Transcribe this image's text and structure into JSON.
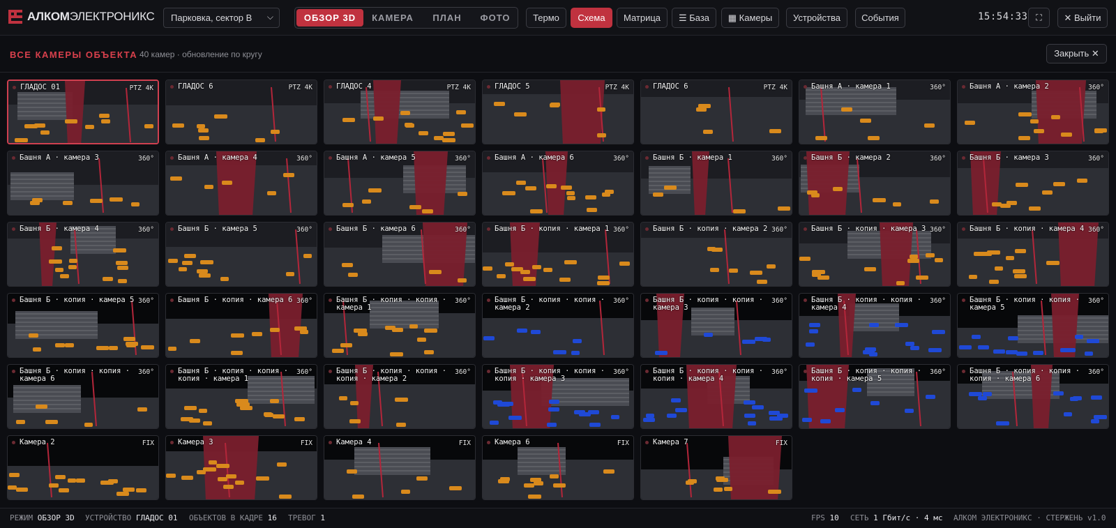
{
  "app": {
    "brand_bold": "АЛКОМ",
    "brand_rest": "ЭЛЕКТРОНИКС",
    "site_select": "Парковка, сектор В",
    "view_tabs": [
      "ОБЗОР 3D",
      "КАМЕРА",
      "ПЛАН",
      "ФОТО"
    ],
    "active_view": "ОБЗОР 3D",
    "toolbar": [
      "Термо",
      "Схема",
      "Матрица",
      "☰ База",
      "▦ Камеры",
      "Устройства",
      "События"
    ],
    "active_tool": "Схема",
    "clock": "15:54:33",
    "fullscreen_icon": "⛶",
    "exit_label": "✕ Выйти"
  },
  "panel": {
    "title": "ВСЕ КАМЕРЫ ОБЪЕКТА",
    "meta": "40 камер · обновление по кругу",
    "close_label": "Закрыть ✕"
  },
  "cameras": [
    {
      "name": "ГЛАДОС 01",
      "badge": "PTZ 4K"
    },
    {
      "name": "ГЛАДОС 6",
      "badge": "PTZ 4K"
    },
    {
      "name": "ГЛАДОС 4",
      "badge": "PTZ 4K"
    },
    {
      "name": "ГЛАДОС 5",
      "badge": "PTZ 4K"
    },
    {
      "name": "ГЛАДОС 6",
      "badge": "PTZ 4K"
    },
    {
      "name": "Башня А · камера 1",
      "badge": "360°"
    },
    {
      "name": "Башня А · камера 2",
      "badge": "360°"
    },
    {
      "name": "Башня А · камера 3",
      "badge": "360°"
    },
    {
      "name": "Башня А · камера 4",
      "badge": "360°"
    },
    {
      "name": "Башня А · камера 5",
      "badge": "360°"
    },
    {
      "name": "Башня А · камера 6",
      "badge": "360°"
    },
    {
      "name": "Башня Б · камера 1",
      "badge": "360°"
    },
    {
      "name": "Башня Б · камера 2",
      "badge": "360°"
    },
    {
      "name": "Башня Б · камера 3",
      "badge": "360°"
    },
    {
      "name": "Башня Б · камера 4",
      "badge": "360°"
    },
    {
      "name": "Башня Б · камера 5",
      "badge": "360°"
    },
    {
      "name": "Башня Б · камера 6",
      "badge": "360°"
    },
    {
      "name": "Башня Б · копия · камера 1",
      "badge": "360°"
    },
    {
      "name": "Башня Б · копия · камера 2",
      "badge": "360°"
    },
    {
      "name": "Башня Б · копия · камера 3",
      "badge": "360°"
    },
    {
      "name": "Башня Б · копия · камера 4",
      "badge": "360°"
    },
    {
      "name": "Башня Б · копия · камера 5",
      "badge": "360°"
    },
    {
      "name": "Башня Б · копия · камера 6",
      "badge": "360°"
    },
    {
      "name": "Башня Б · копия · копия · камера 1",
      "badge": "360°"
    },
    {
      "name": "Башня Б · копия · копия · камера 2",
      "badge": "360°"
    },
    {
      "name": "Башня Б · копия · копия · камера 3",
      "badge": "360°"
    },
    {
      "name": "Башня Б · копия · копия · камера 4",
      "badge": "360°"
    },
    {
      "name": "Башня Б · копия · копия · камера 5",
      "badge": "360°"
    },
    {
      "name": "Башня Б · копия · копия · камера 6",
      "badge": "360°"
    },
    {
      "name": "Башня Б · копия · копия · копия · камера 1",
      "badge": "360°"
    },
    {
      "name": "Башня Б · копия · копия · копия · камера 2",
      "badge": "360°"
    },
    {
      "name": "Башня Б · копия · копия · копия · камера 3",
      "badge": "360°"
    },
    {
      "name": "Башня Б · копия · копия · копия · камера 4",
      "badge": "360°"
    },
    {
      "name": "Башня Б · копия · копия · копия · камера 5",
      "badge": "360°"
    },
    {
      "name": "Башня Б · копия · копия · копия · камера 6",
      "badge": "360°"
    },
    {
      "name": "Камера 2",
      "badge": "FIX"
    },
    {
      "name": "Камера 3",
      "badge": "FIX"
    },
    {
      "name": "Камера 4",
      "badge": "FIX"
    },
    {
      "name": "Камера 6",
      "badge": "FIX"
    },
    {
      "name": "Камера 7",
      "badge": "FIX"
    }
  ],
  "status": {
    "mode_label": "РЕЖИМ",
    "mode_value": "ОБЗОР 3D",
    "device_label": "УСТРОЙСТВО",
    "device_value": "ГЛАДОС 01",
    "objects_label": "ОБЪЕКТОВ В КАДРЕ",
    "objects_value": "16",
    "alarms_label": "ТРЕВОГ",
    "alarms_value": "1",
    "fps_label": "FPS",
    "fps_value": "10",
    "net_label": "СЕТЬ",
    "net_value": "1 Гбит/с · 4 мс",
    "version": "АЛКОМ ЭЛЕКТРОНИКС · СТЕРЖЕНЬ v1.0"
  },
  "colors": {
    "accent": "#c0323f",
    "tower": "#7a1f2d",
    "car": "#d98a1c",
    "bus": "#1f49d6",
    "ground": "#2d2f35"
  }
}
